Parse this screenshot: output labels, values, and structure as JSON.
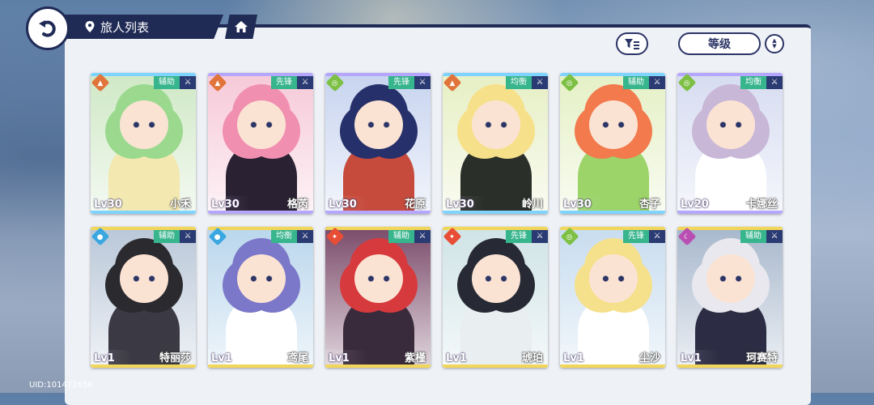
{
  "header": {
    "title": "旅人列表"
  },
  "toolbar": {
    "sort_label": "等级"
  },
  "uid": "UID:101472656",
  "colors": {
    "navy": "#1f2a55",
    "role_bg": "#37b58d",
    "role_icon_bg": "#2a3a72"
  },
  "characters": [
    {
      "name": "小禾",
      "level": "Lv30",
      "role": "辅助",
      "element": "earth",
      "element_color": "#e0743a",
      "hair": "#9bd98f",
      "skin": "#fbe3d4",
      "bg": "#cfe8c5",
      "outfit": "#f2e8b0",
      "rarity": "#7fd4ff"
    },
    {
      "name": "格芮",
      "level": "Lv30",
      "role": "先锋",
      "element": "earth",
      "element_color": "#e0743a",
      "hair": "#f18fb0",
      "skin": "#fbe3d4",
      "bg": "#f6c9d8",
      "outfit": "#2a2233",
      "rarity": "#b5a6ff"
    },
    {
      "name": "花原",
      "level": "Lv30",
      "role": "先锋",
      "element": "wind",
      "element_color": "#7dc043",
      "hair": "#26306a",
      "skin": "#fbe3d4",
      "bg": "#c7d3ef",
      "outfit": "#c64b3d",
      "rarity": "#b5a6ff"
    },
    {
      "name": "岭川",
      "level": "Lv30",
      "role": "均衡",
      "element": "earth",
      "element_color": "#e0743a",
      "hair": "#f6e08a",
      "skin": "#fbe3d4",
      "bg": "#e6efc4",
      "outfit": "#2b2f2a",
      "rarity": "#7fd4ff"
    },
    {
      "name": "杏子",
      "level": "Lv30",
      "role": "辅助",
      "element": "wind",
      "element_color": "#7dc043",
      "hair": "#f27a4d",
      "skin": "#fbe3d4",
      "bg": "#e5f0c5",
      "outfit": "#9cd46a",
      "rarity": "#7fd4ff"
    },
    {
      "name": "卡娜丝",
      "level": "Lv20",
      "role": "均衡",
      "element": "wind",
      "element_color": "#7dc043",
      "hair": "#c9b7d8",
      "skin": "#fbe3d4",
      "bg": "#d6dcf1",
      "outfit": "#ffffff",
      "rarity": "#b5a6ff"
    },
    {
      "name": "特丽莎",
      "level": "Lv1",
      "role": "辅助",
      "element": "water",
      "element_color": "#3aa7e0",
      "hair": "#2b2a2f",
      "skin": "#fbe3d4",
      "bg": "#b9c7d8",
      "outfit": "#3b3a44",
      "rarity": "#f2d65a"
    },
    {
      "name": "鸢尾",
      "level": "Lv1",
      "role": "均衡",
      "element": "water",
      "element_color": "#3aa7e0",
      "hair": "#7b77c9",
      "skin": "#fbe3d4",
      "bg": "#b9d6ec",
      "outfit": "#ffffff",
      "rarity": "#f2d65a"
    },
    {
      "name": "紫槿",
      "level": "Lv1",
      "role": "辅助",
      "element": "fire",
      "element_color": "#e84d35",
      "hair": "#d73a3d",
      "skin": "#fbe3d4",
      "bg": "#7a4b6a",
      "outfit": "#3a2b3c",
      "rarity": "#f2d65a"
    },
    {
      "name": "琥珀",
      "level": "Lv1",
      "role": "先锋",
      "element": "fire",
      "element_color": "#e84d35",
      "hair": "#272a34",
      "skin": "#fbe3d4",
      "bg": "#cfe3e6",
      "outfit": "#e9eef0",
      "rarity": "#f2d65a"
    },
    {
      "name": "尘沙",
      "level": "Lv1",
      "role": "先锋",
      "element": "wind",
      "element_color": "#7dc043",
      "hair": "#f5e08c",
      "skin": "#fbe3d4",
      "bg": "#c7dcef",
      "outfit": "#ffffff",
      "rarity": "#f2d65a"
    },
    {
      "name": "珂赛特",
      "level": "Lv1",
      "role": "辅助",
      "element": "dark",
      "element_color": "#b94fb3",
      "hair": "#e8e8ee",
      "skin": "#fbe3d4",
      "bg": "#a7b7cc",
      "outfit": "#2c2c44",
      "rarity": "#f2d65a"
    }
  ]
}
